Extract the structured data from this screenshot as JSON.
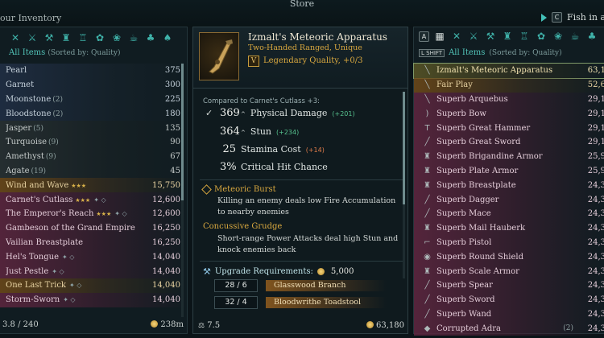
{
  "topbar": {
    "store_tab": "Store",
    "inventory_title": "our Inventory",
    "fish_key": "C",
    "fish_label": "Fish in a"
  },
  "inventory": {
    "sort_title": "All Items",
    "sort_sub": "(Sorted by: Quality)",
    "items": [
      {
        "name": "Pearl",
        "qty": "",
        "value": "375",
        "q": "common",
        "mark": ""
      },
      {
        "name": "Garnet",
        "qty": "",
        "value": "300",
        "q": "common",
        "mark": ""
      },
      {
        "name": "Moonstone",
        "qty": "(2)",
        "value": "225",
        "q": "common",
        "mark": ""
      },
      {
        "name": "Bloodstone",
        "qty": "(2)",
        "value": "180",
        "q": "common",
        "mark": ""
      },
      {
        "name": "Jasper",
        "qty": "(5)",
        "value": "135",
        "q": "ord",
        "mark": ""
      },
      {
        "name": "Turquoise",
        "qty": "(9)",
        "value": "90",
        "q": "ord",
        "mark": ""
      },
      {
        "name": "Amethyst",
        "qty": "(9)",
        "value": "67",
        "q": "ord",
        "mark": ""
      },
      {
        "name": "Agate",
        "qty": "(19)",
        "value": "45",
        "q": "ord",
        "mark": ""
      },
      {
        "name": "Wind and Wave",
        "qty": "",
        "value": "15,750",
        "q": "legend",
        "mark": "stars"
      },
      {
        "name": "Carnet's Cutlass",
        "qty": "",
        "value": "12,600",
        "q": "superb",
        "mark": "stars2"
      },
      {
        "name": "The Emperor's Reach",
        "qty": "",
        "value": "12,600",
        "q": "superb",
        "mark": "stars2"
      },
      {
        "name": "Gambeson of the Grand Empire",
        "qty": "",
        "value": "16,250",
        "q": "superb",
        "mark": ""
      },
      {
        "name": "Vailian Breastplate",
        "qty": "",
        "value": "16,250",
        "q": "superb",
        "mark": ""
      },
      {
        "name": "Hel's Tongue",
        "qty": "",
        "value": "14,040",
        "q": "superb",
        "mark": "eq"
      },
      {
        "name": "Just Pestle",
        "qty": "",
        "value": "14,040",
        "q": "superb",
        "mark": "eq"
      },
      {
        "name": "One Last Trick",
        "qty": "",
        "value": "14,040",
        "q": "legend",
        "mark": "eq"
      },
      {
        "name": "Storm-Sworn",
        "qty": "",
        "value": "14,040",
        "q": "superb",
        "mark": "eq"
      }
    ],
    "weight": "3.8 / 240",
    "money": "238m"
  },
  "detail": {
    "name": "Izmalt's Meteoric Apparatus",
    "subtitle": "Two-Handed Ranged, Unique",
    "tier": "V",
    "quality": "Legendary Quality, +0/3",
    "compare": "Compared to Carnet's Cutlass +3:",
    "stats": [
      {
        "check": "✓",
        "val": "369",
        "arrow": "^",
        "label": "Physical Damage",
        "delta": "(+201)",
        "dc": "g"
      },
      {
        "check": "",
        "val": "364",
        "arrow": "^",
        "label": "Stun",
        "delta": "(+234)",
        "dc": "g"
      },
      {
        "check": "",
        "val": "25",
        "arrow": "",
        "label": "Stamina Cost",
        "delta": "(+14)",
        "dc": "r"
      },
      {
        "check": "",
        "val": "3%",
        "arrow": "",
        "label": "Critical Hit Chance",
        "delta": "",
        "dc": ""
      }
    ],
    "perk1_title": "Meteoric Burst",
    "perk1_text": "Killing an enemy deals low Fire Accumulation to nearby enemies",
    "perk2_title": "Concussive Grudge",
    "perk2_text": "Short-range Power Attacks deal high Stun and knock enemies back",
    "upgrade_label": "Upgrade Requirements:",
    "upgrade_cost": "5,000",
    "materials": [
      {
        "count": "28 / 6",
        "name": "Glasswood Branch"
      },
      {
        "count": "32 / 4",
        "name": "Bloodwrithe Toadstool"
      }
    ],
    "weight": "7.5",
    "price": "63,180"
  },
  "store": {
    "sort_key": "L SHIFT",
    "sort_title": "All Items",
    "sort_sub": "(Sorted by: Quality)",
    "items": [
      {
        "name": "Izmalt's Meteoric Apparatus",
        "value": "63,1",
        "q": "sel",
        "icon": "╲"
      },
      {
        "name": "Fair Play",
        "value": "52,6",
        "q": "legend",
        "icon": "╲"
      },
      {
        "name": "Superb Arquebus",
        "value": "29,1",
        "q": "superb",
        "icon": "╲"
      },
      {
        "name": "Superb Bow",
        "value": "29,1",
        "q": "superb",
        "icon": ")"
      },
      {
        "name": "Superb Great Hammer",
        "value": "29,1",
        "q": "superb",
        "icon": "T"
      },
      {
        "name": "Superb Great Sword",
        "value": "29,1",
        "q": "superb",
        "icon": "╱"
      },
      {
        "name": "Superb Brigandine Armor",
        "value": "25,9",
        "q": "superb",
        "icon": "♜"
      },
      {
        "name": "Superb Plate Armor",
        "value": "25,9",
        "q": "superb",
        "icon": "♜"
      },
      {
        "name": "Superb Breastplate",
        "value": "24,3",
        "q": "superb",
        "icon": "♜"
      },
      {
        "name": "Superb Dagger",
        "value": "24,3",
        "q": "superb",
        "icon": "╱"
      },
      {
        "name": "Superb Mace",
        "value": "24,3",
        "q": "superb",
        "icon": "╱"
      },
      {
        "name": "Superb Mail Hauberk",
        "value": "24,3",
        "q": "superb",
        "icon": "♜"
      },
      {
        "name": "Superb Pistol",
        "value": "24,3",
        "q": "superb",
        "icon": "⌐"
      },
      {
        "name": "Superb Round Shield",
        "value": "24,3",
        "q": "superb",
        "icon": "◉"
      },
      {
        "name": "Superb Scale Armor",
        "value": "24,3",
        "q": "superb",
        "icon": "♜"
      },
      {
        "name": "Superb Spear",
        "value": "24,3",
        "q": "superb",
        "icon": "╱"
      },
      {
        "name": "Superb Sword",
        "value": "24,3",
        "q": "superb",
        "icon": "╱"
      },
      {
        "name": "Superb Wand",
        "value": "24,3",
        "q": "superb",
        "icon": "╱"
      },
      {
        "name": "Corrupted Adra",
        "qty": "(2)",
        "value": "24,3",
        "q": "superb",
        "icon": "◆"
      }
    ]
  },
  "colors": {
    "accent": "#43c0b8",
    "gold": "#d9a83f",
    "superb": "#602640",
    "legendary": "#704a18"
  }
}
